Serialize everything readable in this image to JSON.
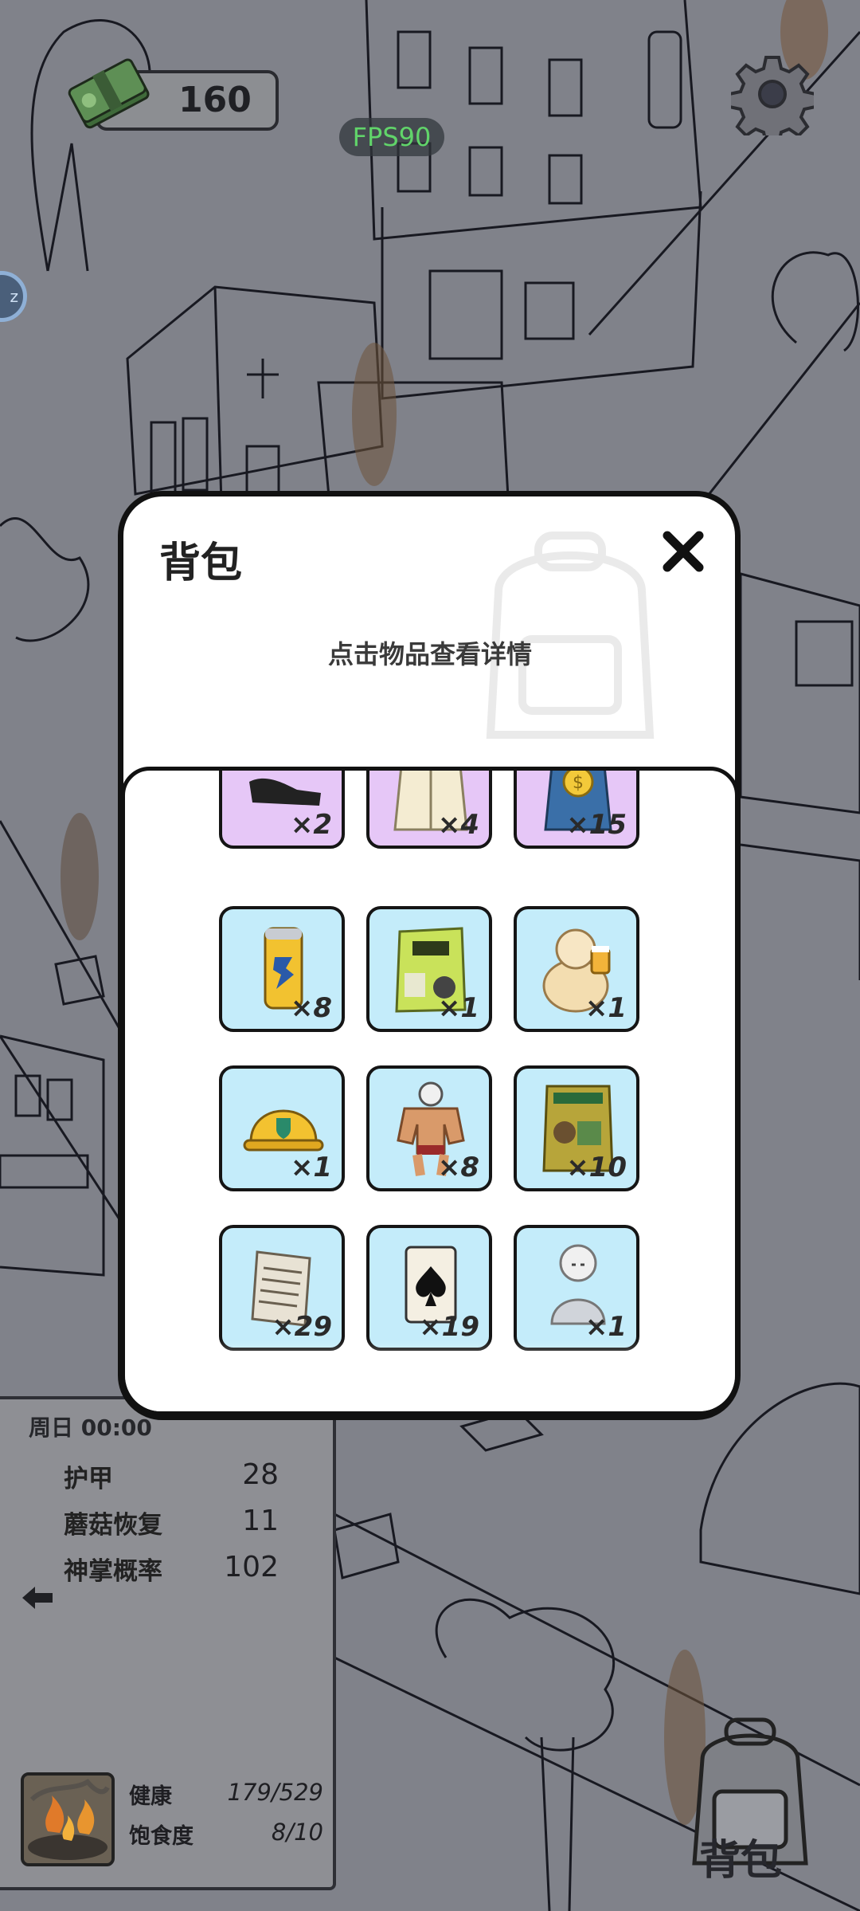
{
  "hud": {
    "money": "160",
    "fps": "FPS90",
    "icons": [
      "cash-stack-icon",
      "gear-icon",
      "sleep-icon"
    ]
  },
  "stats_panel": {
    "time": "周日 00:00",
    "rows": [
      {
        "label": "护甲",
        "value": "28"
      },
      {
        "label": "蘑菇恢复",
        "value": "11"
      },
      {
        "label": "神掌概率",
        "value": "102"
      }
    ],
    "vitals": [
      {
        "label": "健康",
        "value": "179/529"
      },
      {
        "label": "饱食度",
        "value": "8/10"
      }
    ]
  },
  "backpack_button": {
    "label": "背包"
  },
  "modal": {
    "title": "背包",
    "hint": "点击物品查看详情",
    "items": [
      {
        "icon": "shoes-icon",
        "qty": "×2",
        "tint": "purple"
      },
      {
        "icon": "jacket-icon",
        "qty": "×4",
        "tint": "purple"
      },
      {
        "icon": "money-bag-icon",
        "qty": "×15",
        "tint": "purple"
      },
      {
        "icon": "energy-drink-can-icon",
        "qty": "×8",
        "tint": "blue"
      },
      {
        "icon": "chips-bag-icon",
        "qty": "×1",
        "tint": "blue"
      },
      {
        "icon": "beer-buddha-icon",
        "qty": "×1",
        "tint": "blue"
      },
      {
        "icon": "hard-hat-icon",
        "qty": "×1",
        "tint": "blue"
      },
      {
        "icon": "wrestler-icon",
        "qty": "×8",
        "tint": "blue"
      },
      {
        "icon": "feed-sack-icon",
        "qty": "×10",
        "tint": "blue"
      },
      {
        "icon": "document-scroll-icon",
        "qty": "×29",
        "tint": "blue"
      },
      {
        "icon": "ace-of-spades-icon",
        "qty": "×19",
        "tint": "blue"
      },
      {
        "icon": "buddha-statue-icon",
        "qty": "×1",
        "tint": "blue"
      }
    ]
  }
}
